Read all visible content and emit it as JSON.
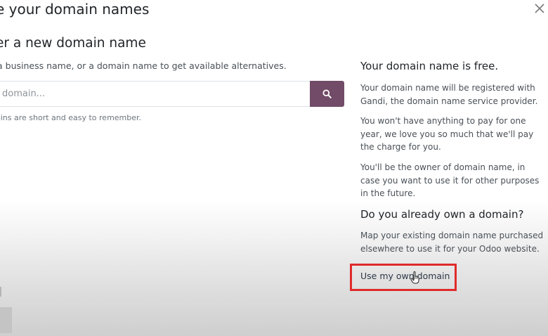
{
  "modal": {
    "title": "e your domain names"
  },
  "new_domain": {
    "heading": "er a new domain name",
    "description": "a business name, or a domain name to get available alternatives.",
    "placeholder": "domain...",
    "hint": "ains are short and easy to remember."
  },
  "info": {
    "free_heading": "Your domain name is free.",
    "free_p1": "Your domain name will be registered with Gandi, the domain name service provider.",
    "free_p2": "You won't have anything to pay for one year, we love you so much that we'll pay the charge for you.",
    "free_p3": "You'll be the owner of domain name, in case you want to use it for other purposes in the future.",
    "own_heading": "Do you already own a domain?",
    "own_p": "Map your existing domain name purchased elsewhere to use it for your Odoo website.",
    "own_link": "Use my own domain"
  },
  "colors": {
    "brand": "#714b67",
    "highlight": "#e02a2a"
  },
  "icons": {
    "close": "close-icon",
    "search": "search-icon",
    "cursor": "hand-pointer-icon"
  }
}
